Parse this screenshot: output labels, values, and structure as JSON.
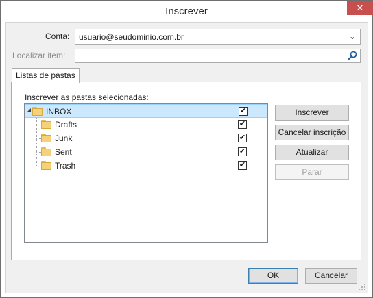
{
  "window": {
    "title": "Inscrever",
    "close_glyph": "✕"
  },
  "account": {
    "label": "Conta:",
    "value": "usuario@seudominio.com.br"
  },
  "search": {
    "label": "Localizar item:",
    "value": "",
    "placeholder": ""
  },
  "tab": {
    "label": "Listas de pastas"
  },
  "panel": {
    "caption": "Inscrever as pastas selecionadas:"
  },
  "folders": [
    {
      "name": "INBOX",
      "checked": true,
      "selected": true,
      "icon": "folder-icon"
    },
    {
      "name": "Drafts",
      "checked": true,
      "icon": "folder-icon"
    },
    {
      "name": "Junk",
      "checked": true,
      "icon": "folder-icon"
    },
    {
      "name": "Sent",
      "checked": true,
      "icon": "folder-icon"
    },
    {
      "name": "Trash",
      "checked": true,
      "icon": "folder-icon"
    }
  ],
  "check_glyph": "✔",
  "buttons": {
    "subscribe": "Inscrever",
    "unsubscribe": "Cancelar inscrição",
    "refresh": "Atualizar",
    "stop": "Parar",
    "ok": "OK",
    "cancel": "Cancelar"
  },
  "colors": {
    "selection": "#cce8ff",
    "close": "#c7504f",
    "search_icon": "#1f5fa5"
  }
}
